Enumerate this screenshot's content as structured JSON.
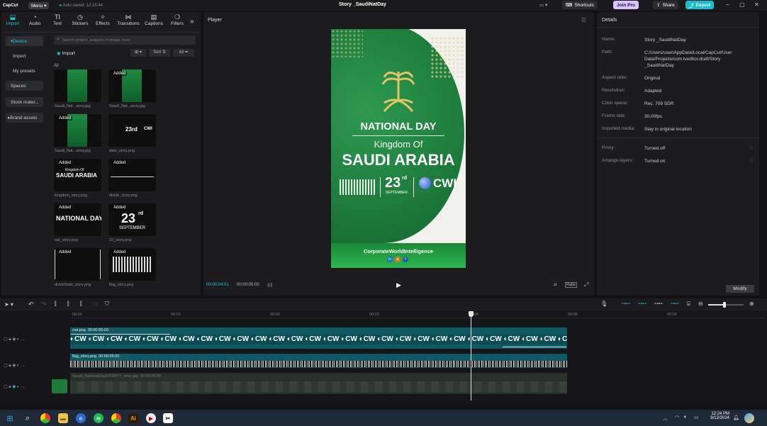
{
  "titlebar": {
    "app_name": "CapCut",
    "menu_label": "Menu",
    "autosave": "Auto saved: 12:15:44",
    "project_title": "Story _SaudiNatDay",
    "shortcuts_label": "Shortcuts",
    "join_pro_label": "Join Pro",
    "share_label": "Share",
    "export_label": "Export"
  },
  "toolbar": {
    "tabs": [
      {
        "label": "Import",
        "icon": "import-icon"
      },
      {
        "label": "Audio",
        "icon": "audio-icon"
      },
      {
        "label": "Text",
        "icon": "text-icon"
      },
      {
        "label": "Stickers",
        "icon": "stickers-icon"
      },
      {
        "label": "Effects",
        "icon": "effects-icon"
      },
      {
        "label": "Transitions",
        "icon": "transitions-icon"
      },
      {
        "label": "Captions",
        "icon": "captions-icon"
      },
      {
        "label": "Filters",
        "icon": "filters-icon"
      }
    ],
    "more": "»"
  },
  "sidebar": {
    "items": [
      {
        "label": "Device",
        "prefix": "▾"
      },
      {
        "label": "Import",
        "prefix": ""
      },
      {
        "label": "My presets",
        "prefix": ""
      },
      {
        "label": "Spaces",
        "prefix": ""
      },
      {
        "label": "Stock mater...",
        "prefix": ""
      },
      {
        "label": "Brand assets",
        "prefix": "▸"
      }
    ]
  },
  "media": {
    "search_placeholder": "Search project, subjects in image, lines",
    "import_label": "Import",
    "sort_label": "Sort",
    "all_filter": "All",
    "all_heading": "All",
    "added_label": "Added",
    "items": [
      {
        "name": "Saudi_Nat...story.jpg",
        "added": false,
        "text": ""
      },
      {
        "name": "Saudi_Nat...story.jpg",
        "added": true,
        "text": ""
      },
      {
        "name": "Saudi_Nat...story.jpg",
        "added": true,
        "text": ""
      },
      {
        "name": "date_story.png",
        "added": false,
        "text": "23rd"
      },
      {
        "name": "kingdom_story.png",
        "added": true,
        "text": "SAUDI ARABIA"
      },
      {
        "name": "divide_story.png",
        "added": true,
        "text": ""
      },
      {
        "name": "nat_story.png",
        "added": true,
        "text": "NATIONAL DAY"
      },
      {
        "name": "23_story.png",
        "added": true,
        "text": "23"
      },
      {
        "name": "divideDate_story.png",
        "added": true,
        "text": ""
      },
      {
        "name": "flag_story.png",
        "added": true,
        "text": ""
      }
    ],
    "thumb_small_text": {
      "kingdom_of": "Kingdom Of",
      "rd": "rd",
      "september": "SEPTEMBER",
      "cwi": "CWI"
    }
  },
  "player": {
    "title": "Player",
    "current_time": "00:00:04:01",
    "total_time": "00:00:05:00",
    "ratio_label": "Ratio",
    "preview": {
      "heading": "NATIONAL DAY",
      "kingdom_of": "Kingdom Of",
      "country": "SAUDI ARABIA",
      "day": "23",
      "day_suffix": "rd",
      "month": "SEPTEMBER",
      "cwi": "CWI",
      "footer": "CorporateWorldIntelligence",
      "social": [
        "in",
        "●",
        "f"
      ]
    }
  },
  "details": {
    "title": "Details",
    "rows": [
      {
        "key": "Name:",
        "value": "Story _SaudiNatDay"
      },
      {
        "key": "Path:",
        "value": "C:/Users/user/AppData/Local/CapCut/User Data/Projects/com.lveditor.draft/Story _SaudiNatDay"
      },
      {
        "key": "Aspect ratio:",
        "value": "Original"
      },
      {
        "key": "Resolution:",
        "value": "Adapted"
      },
      {
        "key": "Color space:",
        "value": "Rec. 709 SDR"
      },
      {
        "key": "Frame rate:",
        "value": "30.00fps"
      },
      {
        "key": "Imported media:",
        "value": "Stay in original location"
      },
      {
        "key": "Proxy:",
        "value": "Turned off"
      },
      {
        "key": "Arrange layers:",
        "value": "Turned on"
      }
    ],
    "modify_label": "Modify"
  },
  "timeline": {
    "ticks": [
      "00:00",
      "00:01",
      "00:02",
      "00:03",
      "00:04",
      "00:05",
      "00:06"
    ],
    "clips": [
      {
        "name": "cwi.png",
        "duration": "00:00:05:00",
        "pattern": "CW"
      },
      {
        "name": "flag_story.png",
        "duration": "00:00:05:00",
        "pattern": ""
      },
      {
        "name": "Saudi_NationalDaySTORYY_story.jpg",
        "duration": "00:00:05:00",
        "pattern": ""
      }
    ],
    "zoom_level": 0.45
  },
  "taskbar": {
    "time": "12:24 PM",
    "date": "9/12/2024"
  },
  "colors": {
    "accent": "#1ec8d6",
    "green": "#1c7a3c",
    "join_pro": "#d6c4ff",
    "export": "#15c0cf"
  }
}
